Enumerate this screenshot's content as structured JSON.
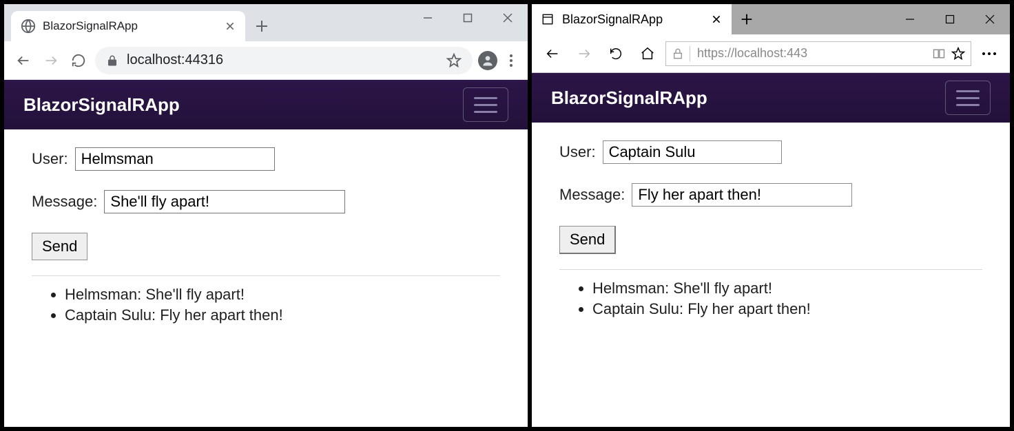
{
  "windows": [
    {
      "id": "chrome",
      "tab_title": "BlazorSignalRApp",
      "address": "localhost:44316",
      "app": {
        "brand": "BlazorSignalRApp",
        "user_label": "User:",
        "user_value": "Helmsman",
        "message_label": "Message:",
        "message_value": "She'll fly apart!",
        "send_label": "Send",
        "messages": [
          "Helmsman: She'll fly apart!",
          "Captain Sulu: Fly her apart then!"
        ]
      }
    },
    {
      "id": "edge",
      "tab_title": "BlazorSignalRApp",
      "address": "https://localhost:443",
      "app": {
        "brand": "BlazorSignalRApp",
        "user_label": "User:",
        "user_value": "Captain Sulu",
        "message_label": "Message:",
        "message_value": "Fly her apart then!",
        "send_label": "Send",
        "messages": [
          "Helmsman: She'll fly apart!",
          "Captain Sulu: Fly her apart then!"
        ]
      }
    }
  ]
}
